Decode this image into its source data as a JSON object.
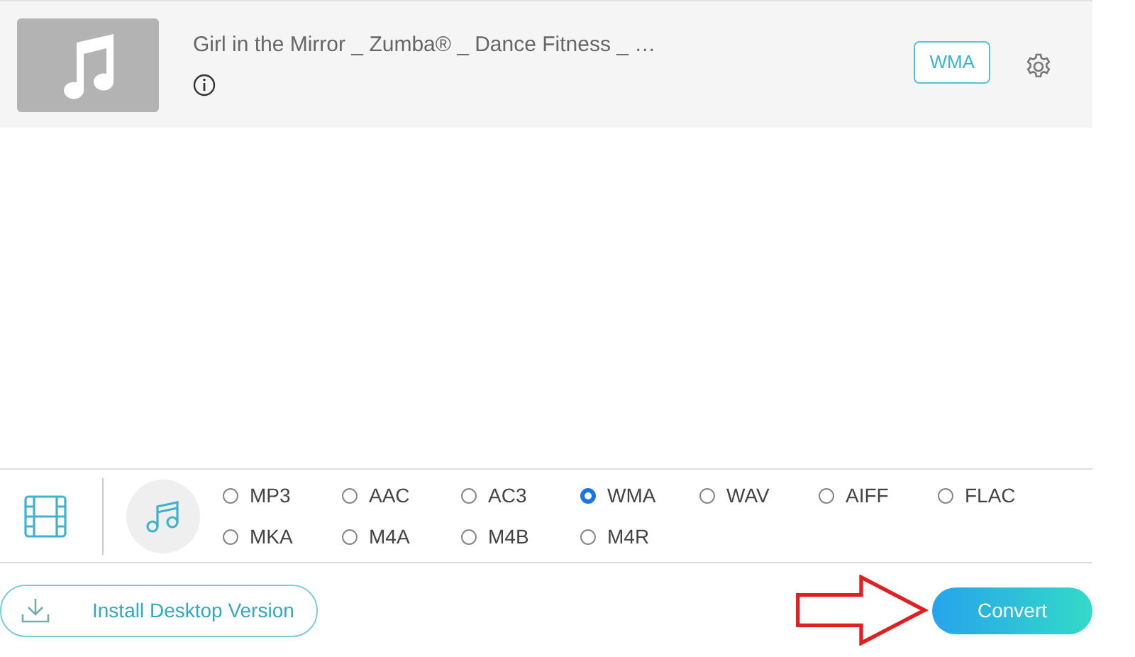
{
  "file": {
    "title": "Girl in the Mirror _ Zumba® _ Dance Fitness _ …",
    "format_badge": "WMA"
  },
  "formats": [
    {
      "label": "MP3",
      "selected": false
    },
    {
      "label": "AAC",
      "selected": false
    },
    {
      "label": "AC3",
      "selected": false
    },
    {
      "label": "WMA",
      "selected": true
    },
    {
      "label": "WAV",
      "selected": false
    },
    {
      "label": "AIFF",
      "selected": false
    },
    {
      "label": "FLAC",
      "selected": false
    },
    {
      "label": "MKA",
      "selected": false
    },
    {
      "label": "M4A",
      "selected": false
    },
    {
      "label": "M4B",
      "selected": false
    },
    {
      "label": "M4R",
      "selected": false
    }
  ],
  "install_button": "Install Desktop Version",
  "convert_button": "Convert"
}
